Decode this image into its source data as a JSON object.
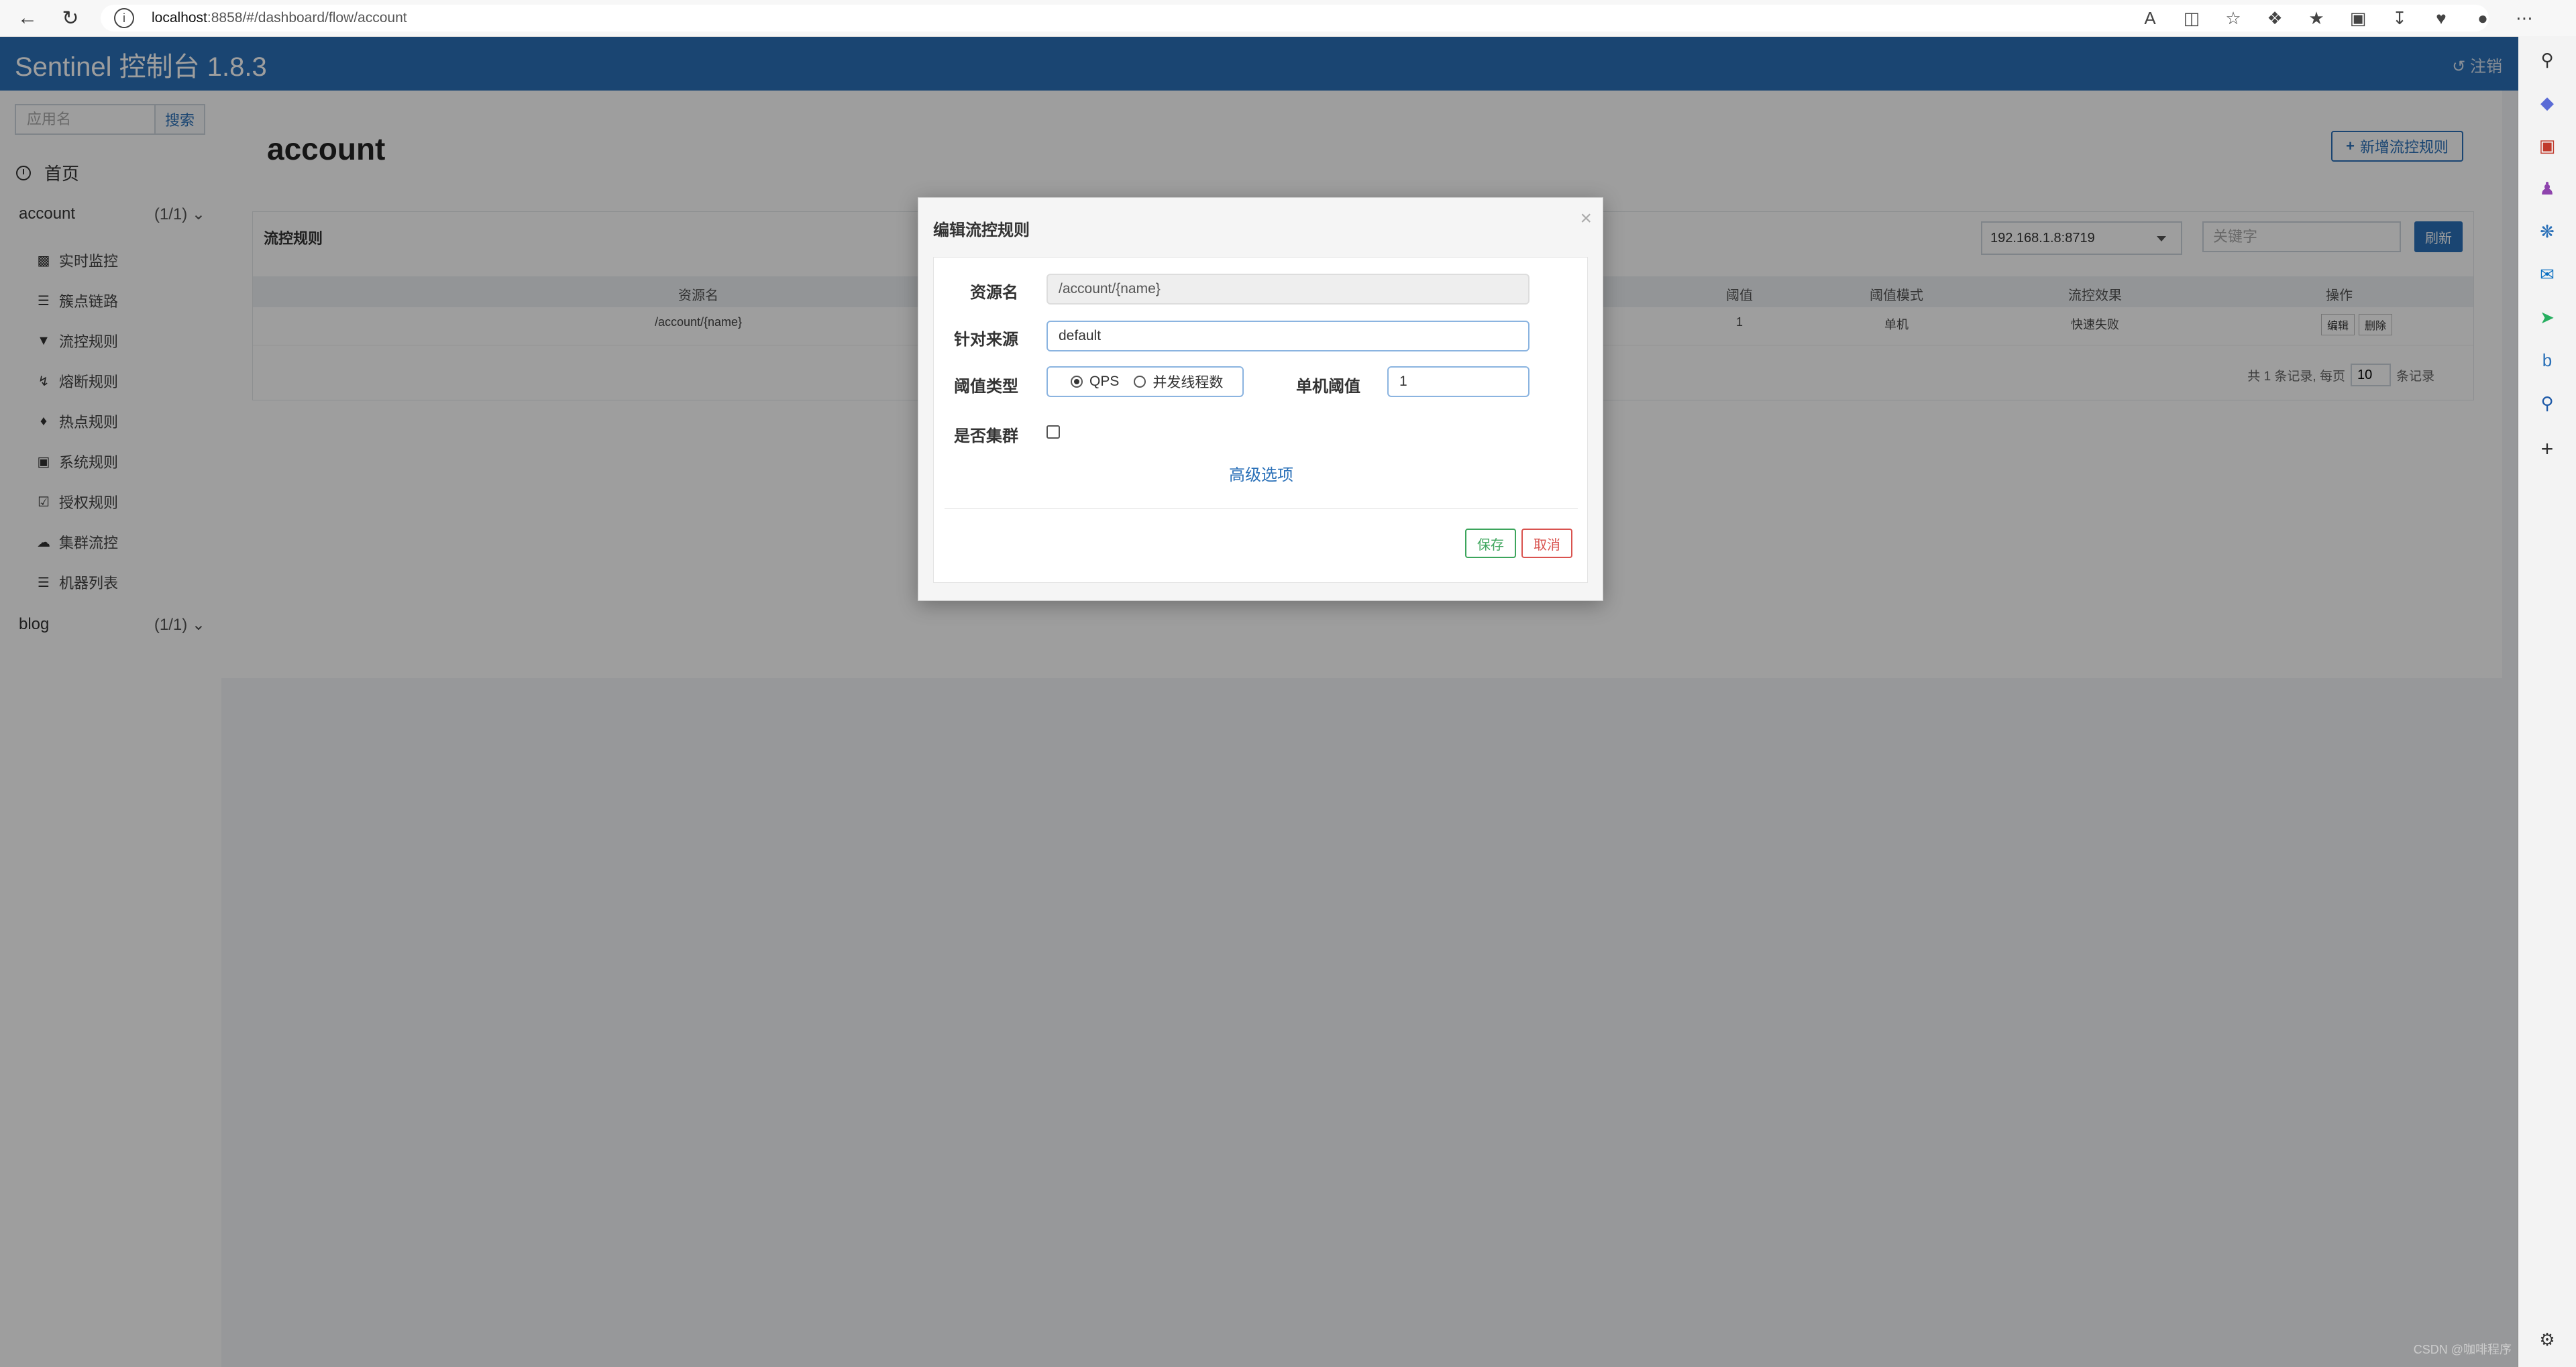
{
  "browser": {
    "url_host": "localhost",
    "url_rest": ":8858/#/dashboard/flow/account"
  },
  "header": {
    "brand": "Sentinel 控制台 1.8.3",
    "logout": "注销"
  },
  "sidebar": {
    "search_placeholder": "应用名",
    "search_button": "搜索",
    "home": "首页",
    "apps": [
      {
        "name": "account",
        "count": "(1/1)"
      },
      {
        "name": "blog",
        "count": "(1/1)"
      }
    ],
    "menu": [
      {
        "label": "实时监控",
        "icon": "bar-chart-icon"
      },
      {
        "label": "簇点链路",
        "icon": "list-icon"
      },
      {
        "label": "流控规则",
        "icon": "filter-icon"
      },
      {
        "label": "熔断规则",
        "icon": "bolt-icon"
      },
      {
        "label": "热点规则",
        "icon": "fire-icon"
      },
      {
        "label": "系统规则",
        "icon": "lock-icon"
      },
      {
        "label": "授权规则",
        "icon": "check-square-icon"
      },
      {
        "label": "集群流控",
        "icon": "cloud-icon"
      },
      {
        "label": "机器列表",
        "icon": "th-list-icon"
      }
    ]
  },
  "main": {
    "title": "account",
    "add_button": "新增流控规则",
    "panel_title": "流控规则",
    "machine_select": "192.168.1.8:8719",
    "keyword_placeholder": "关键字",
    "refresh_button": "刷新",
    "columns": [
      "资源名",
      "阈值",
      "阈值模式",
      "流控效果",
      "操作"
    ],
    "rows": [
      {
        "resource": "/account/{name}",
        "threshold": "1",
        "mode": "单机",
        "effect": "快速失败",
        "edit": "编辑",
        "delete": "删除"
      }
    ],
    "pager_prefix": "共 1 条记录, 每页",
    "page_size": "10",
    "pager_suffix": "条记录"
  },
  "dialog": {
    "title": "编辑流控规则",
    "close": "×",
    "resource_label": "资源名",
    "resource_value": "/account/{name}",
    "origin_label": "针对来源",
    "origin_value": "default",
    "threshold_type_label": "阈值类型",
    "option_qps": "QPS",
    "option_threads": "并发线程数",
    "selected_type": "QPS",
    "single_threshold_label": "单机阈值",
    "single_threshold_value": "1",
    "cluster_label": "是否集群",
    "cluster_checked": false,
    "advanced": "高级选项",
    "save": "保存",
    "cancel": "取消"
  },
  "watermark": "CSDN @咖啡程序"
}
